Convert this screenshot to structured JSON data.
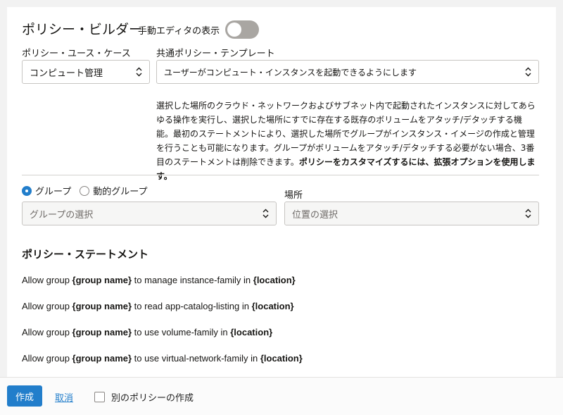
{
  "header": {
    "title": "ポリシー・ビルダー",
    "manual_editor_label": "手動エディタの表示",
    "manual_editor_on": false
  },
  "use_case": {
    "label": "ポリシー・ユース・ケース",
    "value": "コンピュート管理"
  },
  "template": {
    "label": "共通ポリシー・テンプレート",
    "value": "ユーザーがコンピュート・インスタンスを起動できるようにします"
  },
  "description": {
    "text": "選択した場所のクラウド・ネットワークおよびサブネット内で起動されたインスタンスに対してあらゆる操作を実行し、選択した場所にすでに存在する既存のボリュームをアタッチ/デタッチする機能。最初のステートメントにより、選択した場所でグループがインスタンス・イメージの作成と管理を行うことも可能になります。グループがボリュームをアタッチ/デタッチする必要がない場合、3番目のステートメントは削除できます。",
    "bold": "ポリシーをカスタマイズするには、拡張オプションを使用します。"
  },
  "group_type": {
    "options": [
      "グループ",
      "動的グループ"
    ],
    "selected": "グループ"
  },
  "group_select": {
    "placeholder": "グループの選択"
  },
  "location": {
    "label": "場所",
    "placeholder": "位置の選択"
  },
  "statements": {
    "title": "ポリシー・ステートメント",
    "items": [
      {
        "prefix": "Allow group ",
        "group": "{group name}",
        "middle": " to manage instance-family in ",
        "loc": "{location}"
      },
      {
        "prefix": "Allow group ",
        "group": "{group name}",
        "middle": " to read app-catalog-listing in ",
        "loc": "{location}"
      },
      {
        "prefix": "Allow group ",
        "group": "{group name}",
        "middle": " to use volume-family in ",
        "loc": "{location}"
      },
      {
        "prefix": "Allow group ",
        "group": "{group name}",
        "middle": " to use virtual-network-family in ",
        "loc": "{location}"
      }
    ]
  },
  "footer": {
    "create_label": "作成",
    "cancel_label": "取消",
    "another_label": "別のポリシーの作成"
  },
  "colors": {
    "accent": "#227ecb",
    "toggle_off": "#a9a6a2"
  }
}
